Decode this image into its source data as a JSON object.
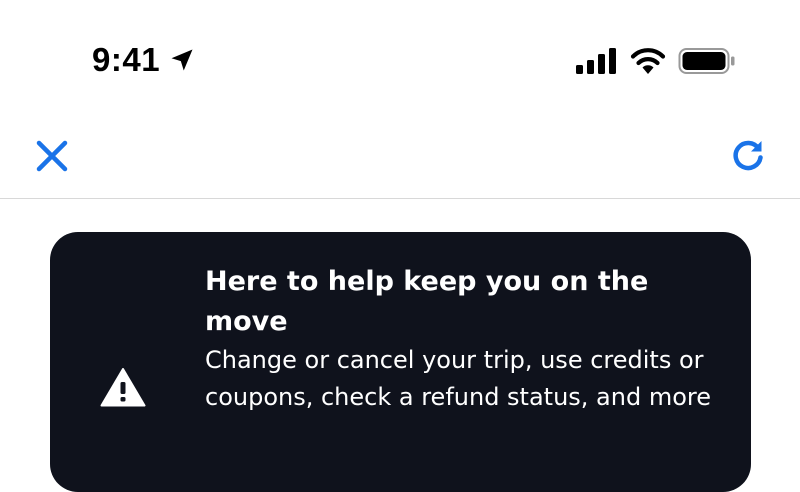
{
  "status_bar": {
    "time": "9:41",
    "icons": {
      "location": "location-arrow-icon",
      "signal": "cellular-signal-icon",
      "wifi": "wifi-icon",
      "battery": "battery-icon"
    }
  },
  "nav": {
    "close_icon": "close-icon",
    "refresh_icon": "refresh-icon"
  },
  "help_card": {
    "title": "Here to help keep you on the move",
    "body": "Change or cancel your trip, use credits or coupons, check a refund status, and more",
    "icon": "warning-icon"
  },
  "colors": {
    "accent": "#1a73e8",
    "card_background": "#0f121c",
    "divider": "#d8d8d8"
  }
}
